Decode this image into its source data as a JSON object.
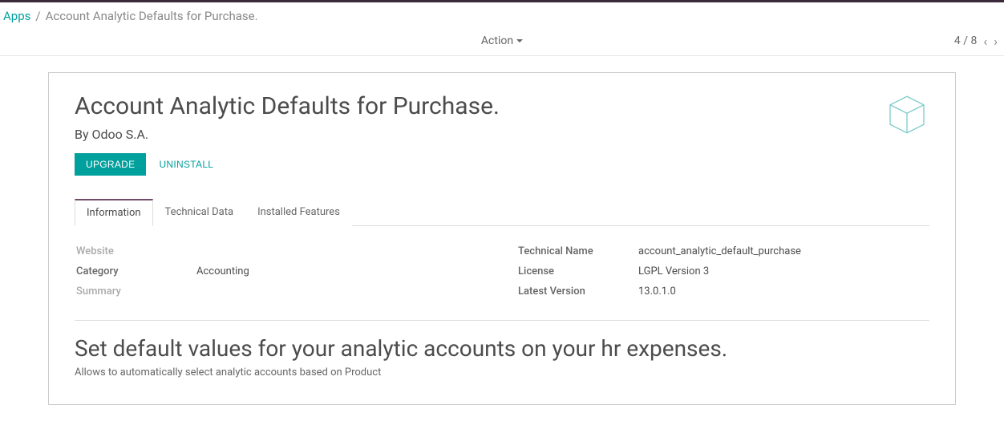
{
  "breadcrumb": {
    "root": "Apps",
    "sep": "/",
    "current": "Account Analytic Defaults for Purchase."
  },
  "controls": {
    "action_label": "Action",
    "pager_text": "4 / 8"
  },
  "module": {
    "title": "Account Analytic Defaults for Purchase.",
    "author_prefix": "By ",
    "author": "Odoo S.A.",
    "upgrade_label": "UPGRADE",
    "uninstall_label": "UNINSTALL"
  },
  "tabs": {
    "information": "Information",
    "technical_data": "Technical Data",
    "installed_features": "Installed Features"
  },
  "info": {
    "labels": {
      "website": "Website",
      "category": "Category",
      "summary": "Summary",
      "technical_name": "Technical Name",
      "license": "License",
      "latest_version": "Latest Version"
    },
    "values": {
      "website": "",
      "category": "Accounting",
      "summary": "",
      "technical_name": "account_analytic_default_purchase",
      "license": "LGPL Version 3",
      "latest_version": "13.0.1.0"
    }
  },
  "description": {
    "heading": "Set default values for your analytic accounts on your hr expenses.",
    "body": "Allows to automatically select analytic accounts based on Product"
  }
}
